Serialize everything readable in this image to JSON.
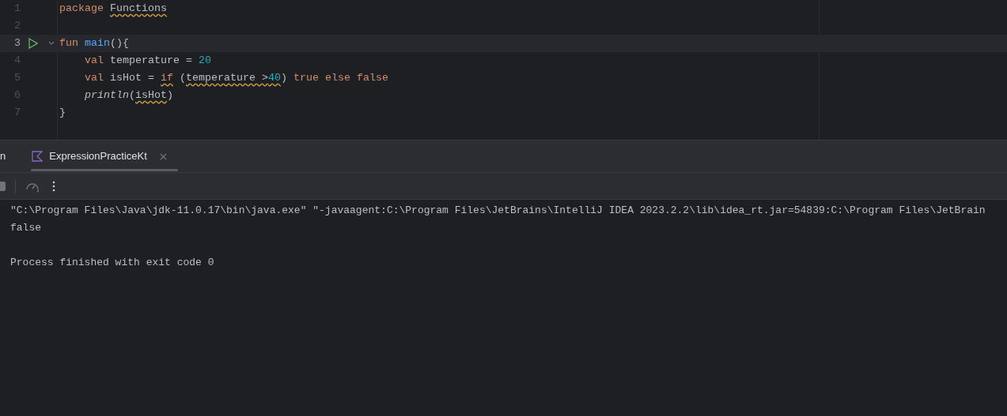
{
  "editor": {
    "lines": [
      {
        "number": "1",
        "current": false,
        "run": false,
        "fold": false,
        "indented": false,
        "tokens": [
          {
            "text": "package ",
            "kind": "keyword",
            "warning": false
          },
          {
            "text": "Functions",
            "kind": "plain",
            "warning": true
          }
        ]
      },
      {
        "number": "2",
        "current": false,
        "run": false,
        "fold": false
      },
      {
        "number": "3",
        "current": true,
        "run": true,
        "fold": true,
        "indented": false,
        "tokens": [
          {
            "text": "fun ",
            "kind": "keyword",
            "warning": false
          },
          {
            "text": "main",
            "kind": "function",
            "warning": false
          },
          {
            "text": "(){",
            "kind": "plain",
            "warning": false
          }
        ]
      },
      {
        "number": "4",
        "current": false,
        "run": false,
        "fold": false,
        "indented": true,
        "tokens": [
          {
            "text": "val ",
            "kind": "keyword",
            "warning": false
          },
          {
            "text": "temperature = ",
            "kind": "plain",
            "warning": false
          },
          {
            "text": "20",
            "kind": "number",
            "warning": false
          }
        ]
      },
      {
        "number": "5",
        "current": false,
        "run": false,
        "fold": false,
        "indented": true,
        "tokens": [
          {
            "text": "val ",
            "kind": "keyword",
            "warning": false
          },
          {
            "text": "isHot = ",
            "kind": "plain",
            "warning": false
          },
          {
            "text": "if",
            "kind": "keyword",
            "warning": true
          },
          {
            "text": " (",
            "kind": "plain",
            "warning": false
          },
          {
            "text": "temperature >",
            "kind": "plain",
            "warning": true
          },
          {
            "text": "40",
            "kind": "number",
            "warning": true
          },
          {
            "text": ") ",
            "kind": "plain",
            "warning": false
          },
          {
            "text": "true else false",
            "kind": "keyword",
            "warning": false
          }
        ]
      },
      {
        "number": "6",
        "current": false,
        "run": false,
        "fold": false,
        "indented": true,
        "tokens": [
          {
            "text": "println",
            "kind": "call",
            "warning": false
          },
          {
            "text": "(",
            "kind": "plain",
            "warning": false
          },
          {
            "text": "isHot",
            "kind": "plain",
            "warning": true
          },
          {
            "text": ")",
            "kind": "plain",
            "warning": false
          }
        ]
      },
      {
        "number": "7",
        "current": false,
        "run": false,
        "fold": false,
        "indented": false,
        "tokens": [
          {
            "text": "}",
            "kind": "plain",
            "warning": false
          }
        ]
      }
    ]
  },
  "run_panel": {
    "tabs": [
      {
        "label": "n",
        "selected": false,
        "icon": false,
        "closable": false
      },
      {
        "label": "ExpressionPracticeKt",
        "selected": true,
        "icon": true,
        "closable": true
      }
    ],
    "console": [
      [
        "\"C:\\Program Files\\Java\\jdk-11.0.17\\bin\\java.exe\" \"-javaagent:C:\\Program Files\\JetBrains\\IntelliJ IDEA 2023.2.2\\lib\\idea_rt.jar=54839:C:\\Program Files\\JetBrain",
        "false"
      ],
      [
        "Process finished with exit code 0"
      ]
    ]
  }
}
